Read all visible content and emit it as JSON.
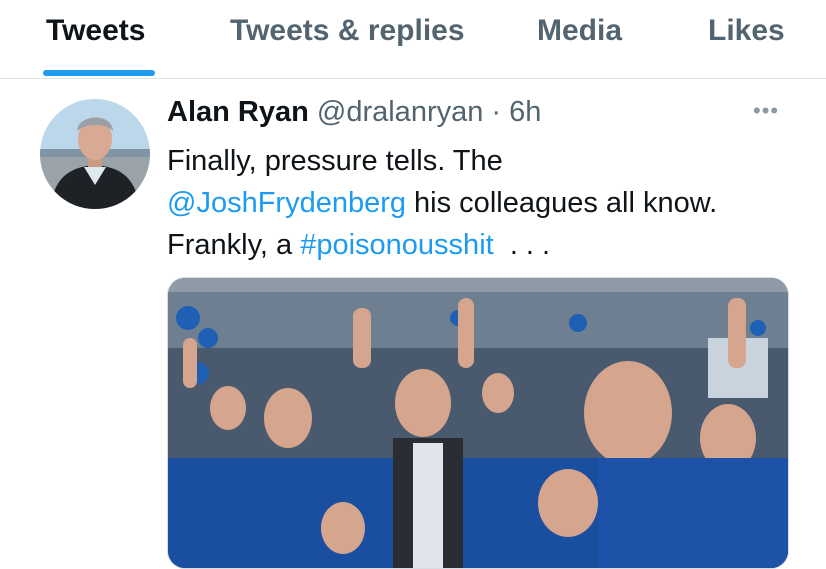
{
  "tabs": [
    {
      "label": "Tweets",
      "active": true
    },
    {
      "label": "Tweets & replies",
      "active": false
    },
    {
      "label": "Media",
      "active": false
    },
    {
      "label": "Likes",
      "active": false
    }
  ],
  "tweet": {
    "author_name": "Alan Ryan",
    "handle": "@dralanryan",
    "separator": "·",
    "time": "6h",
    "more_icon": "more-horizontal-icon",
    "text": {
      "line1": "Finally, pressure tells. The",
      "mention": "@JoshFrydenberg",
      "line2_rest": " his colleagues all know.",
      "line3_prefix": "Frankly, a ",
      "hashtag": "#poisonousshit",
      "ellipsis": "  . . ."
    }
  },
  "colors": {
    "accent": "#1d9bf0",
    "text_primary": "#0f1419",
    "text_secondary": "#536471",
    "divider": "#e1e4e8"
  }
}
